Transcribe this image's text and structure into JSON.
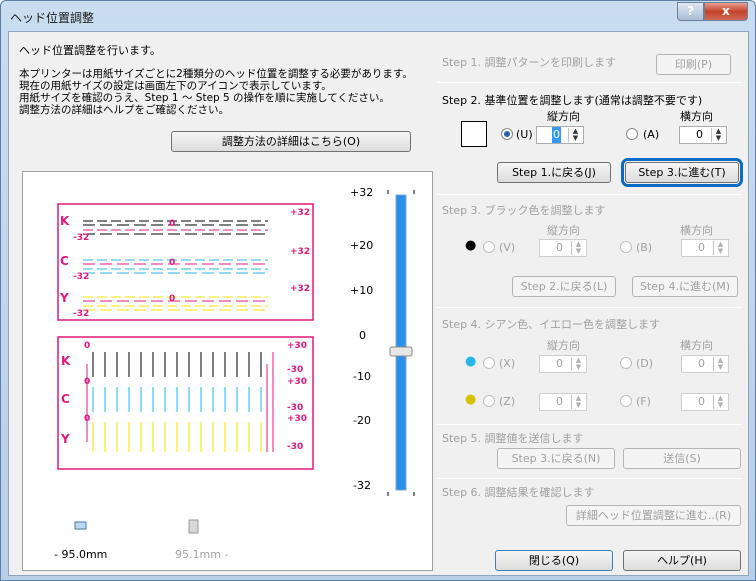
{
  "window": {
    "title": "ヘッド位置調整",
    "help_button": "?",
    "close_button": "x"
  },
  "left": {
    "intro": "ヘッド位置調整を行います。",
    "desc1": "本プリンターは用紙サイズごとに2種類分のヘッド位置を調整する必要があります。",
    "desc2": "現在の用紙サイズの設定は画面左下のアイコンで表示しています。",
    "desc3": "用紙サイズを確認のうえ、Step 1 ～ Step 5 の操作を順に実施してください。",
    "desc4": "調整方法の詳細はヘルプをご確認ください。",
    "details_button": "調整方法の詳細はこちら(O)",
    "size_current": "- 95.0mm",
    "size_other": "95.1mm -"
  },
  "preview": {
    "plus32": "+32",
    "minus32": "-32",
    "zero": "0",
    "plus30": "+30",
    "minus30": "-30",
    "labels_top": [
      "K",
      "C",
      "Y"
    ],
    "labels_bottom": [
      "K",
      "C",
      "Y"
    ]
  },
  "scale": {
    "ticks": [
      "+32",
      "+20",
      "+10",
      "0",
      "-10",
      "-20",
      "-32"
    ]
  },
  "step1": {
    "label": "Step 1. 調整パターンを印刷します",
    "print_button": "印刷(P)"
  },
  "step2": {
    "label": "Step 2. 基準位置を調整します(通常は調整不要です)",
    "vertical": "縦方向",
    "horizontal": "横方向",
    "radio_u": "(U)",
    "radio_a": "(A)",
    "u_value": "0",
    "a_value": "0",
    "back_button": "Step 1.に戻る(J)",
    "next_button": "Step 3.に進む(T)"
  },
  "step3": {
    "label": "Step 3. ブラック色を調整します",
    "vertical": "縦方向",
    "horizontal": "横方向",
    "radio_v": "(V)",
    "radio_b": "(B)",
    "v_value": "0",
    "b_value": "0",
    "back_button": "Step 2.に戻る(L)",
    "next_button": "Step 4.に進む(M)"
  },
  "step4": {
    "label": "Step 4. シアン色、イエロー色を調整します",
    "vertical": "縦方向",
    "horizontal": "横方向",
    "radio_x": "(X)",
    "radio_d": "(D)",
    "radio_z": "(Z)",
    "radio_f": "(F)",
    "x_value": "0",
    "d_value": "0",
    "z_value": "0",
    "f_value": "0"
  },
  "step5": {
    "label": "Step 5. 調整値を送信します",
    "back_button": "Step 3.に戻る(N)",
    "send_button": "送信(S)"
  },
  "step6": {
    "label": "Step 6. 調整結果を確認します",
    "detail_button": "詳細ヘッド位置調整に進む..(R)"
  },
  "footer": {
    "close_button": "閉じる(Q)",
    "help_button": "ヘルプ(H)"
  },
  "colors": {
    "accent": "#0a6bc4",
    "magenta": "#e0197d",
    "cyan": "#29b6e8",
    "yellow": "#f5e400",
    "black": "#000000",
    "slider": "#2b8fe8"
  }
}
